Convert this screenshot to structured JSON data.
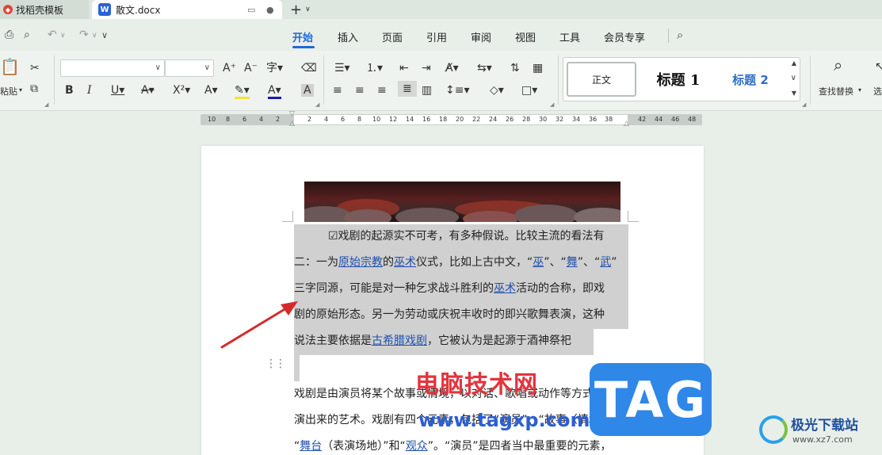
{
  "tabs": [
    {
      "label": "找稻壳模板"
    },
    {
      "label": "散文.docx"
    }
  ],
  "menu": [
    "开始",
    "插入",
    "页面",
    "引用",
    "审阅",
    "视图",
    "工具",
    "会员专享"
  ],
  "ribbon": {
    "paste_label": "粘贴",
    "find_replace_label": "查找替换",
    "select_label": "选",
    "styles": {
      "normal": "正文",
      "h1": "标题 1",
      "h2": "标题 2"
    }
  },
  "ruler": {
    "left_numbers": [
      "10",
      "8",
      "6",
      "4",
      "2"
    ],
    "right_numbers": [
      "2",
      "4",
      "6",
      "8",
      "10",
      "12",
      "14",
      "16",
      "18",
      "20",
      "22",
      "24",
      "26",
      "28",
      "30",
      "32",
      "34",
      "36",
      "38",
      "42",
      "44",
      "46",
      "48"
    ]
  },
  "document": {
    "para1": {
      "l1": "☑戏剧的起源实不可考，有多种假说。比较主流的看法有",
      "l2_a": "二：一为",
      "l2_link1": "原始宗教",
      "l2_b": "的",
      "l2_link2": "巫术",
      "l2_c": "仪式，比如上古中文，“",
      "l2_link3": "巫",
      "l2_d": "”、“",
      "l2_link4": "舞",
      "l2_e": "”、“",
      "l2_link5": "武",
      "l2_f": "”",
      "l3_a": "三字同源，可能是对一种乞求战斗胜利的",
      "l3_link": "巫术",
      "l3_b": "活动的合称，即戏",
      "l4": "剧的原始形态。另一为劳动或庆祝丰收时的即兴歌舞表演，这种",
      "l5_a": "说法主要依据是",
      "l5_link": "古希腊戏剧",
      "l5_b": "，它被认为是起源于酒神祭祀"
    },
    "para2": {
      "l1": "戏剧是由演员将某个故事或情境，以对话、歌唱或动作等方式表",
      "l2": "演出来的艺术。戏剧有四个元素，包括了“演员”、“故事（情境）”、",
      "l3_a": "“",
      "l3_link1": "舞台",
      "l3_b": "（表演场地）”和“",
      "l3_link2": "观众",
      "l3_c": "”。“演员”是四者当中最重要的元素，"
    }
  },
  "watermarks": {
    "site_name": "电脑技术网",
    "site_url": "www.tagxp.com",
    "tag": "TAG",
    "brand_cn": "极光下载站",
    "brand_url": "www.xz7.com"
  }
}
